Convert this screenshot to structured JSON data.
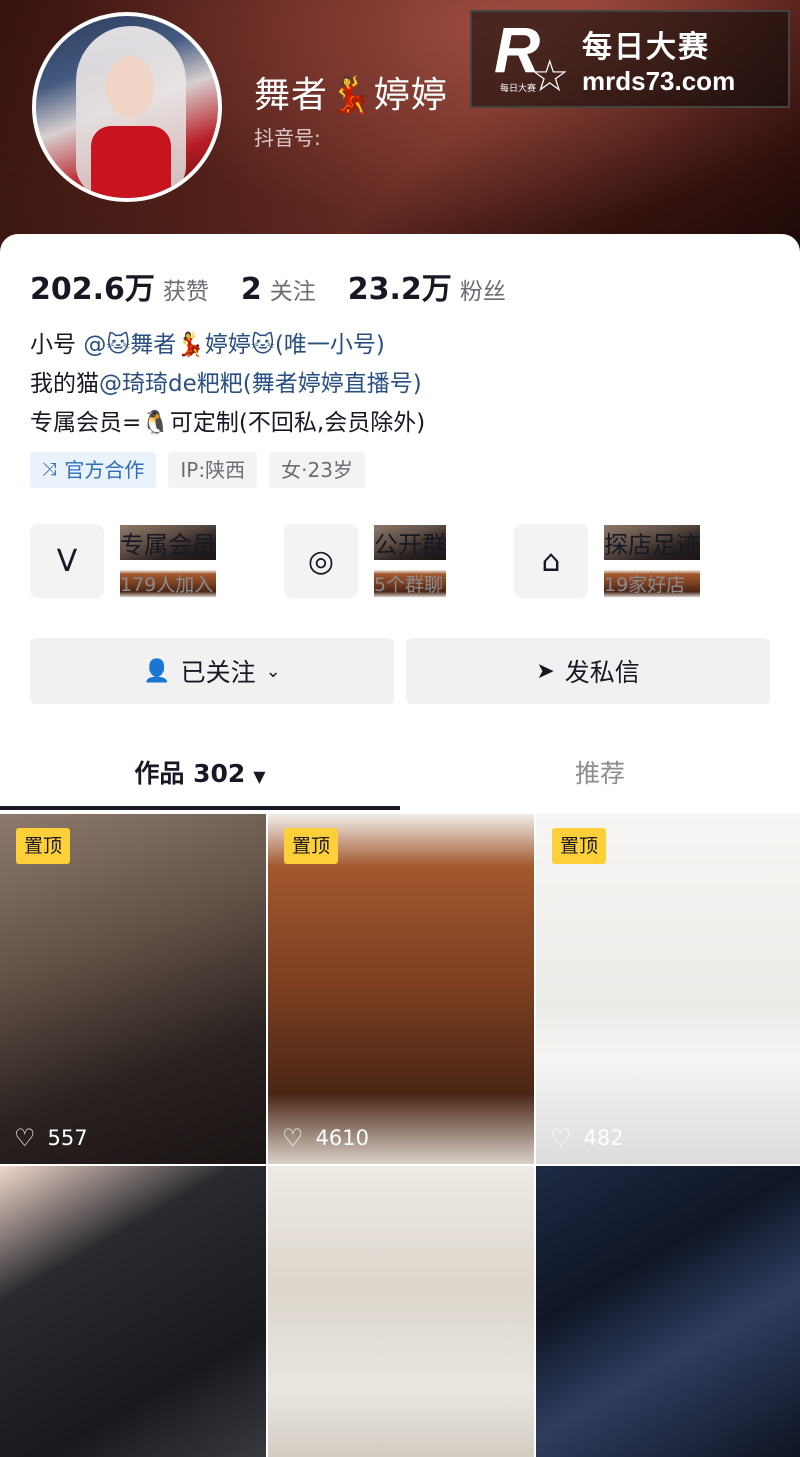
{
  "profile": {
    "nickname": "舞者💃婷婷",
    "douyin_id_label": "抖音号:"
  },
  "watermark": {
    "logo_letter": "R",
    "logo_small": "每日大赛",
    "title": "每日大赛",
    "url": "mrds73.com"
  },
  "stats": [
    {
      "num": "202.6万",
      "label": "获赞"
    },
    {
      "num": "2",
      "label": "关注"
    },
    {
      "num": "23.2万",
      "label": "粉丝"
    }
  ],
  "bio": {
    "line1_prefix": "小号",
    "line1_link": "@🐱舞者💃婷婷🐱",
    "line1_suffix": "(唯一小号)",
    "line2_prefix": "我的猫",
    "line2_link": "@琦琦de粑粑",
    "line2_suffix": "(舞者婷婷直播号)",
    "line3": "专属会员=🐧可定制(不回私,会员除外)"
  },
  "tags": {
    "official": "官方合作",
    "ip": "IP:陕西",
    "gender_age": "女·23岁"
  },
  "services": [
    {
      "icon": "vip-icon",
      "title": "专属会员",
      "sub": "179人加入"
    },
    {
      "icon": "chat-group-icon",
      "title": "公开群",
      "sub": "5个群聊"
    },
    {
      "icon": "store-icon",
      "title": "探店足迹",
      "sub": "19家好店"
    }
  ],
  "actions": {
    "follow": "已关注",
    "message": "发私信"
  },
  "tabs": {
    "works": "作品 302",
    "recommend": "推荐"
  },
  "videos": [
    {
      "pinned": "置顶",
      "likes": "557"
    },
    {
      "pinned": "置顶",
      "likes": "4610"
    },
    {
      "pinned": "置顶",
      "likes": "482"
    },
    {
      "pinned": "",
      "likes": ""
    },
    {
      "pinned": "",
      "likes": ""
    },
    {
      "pinned": "",
      "likes": ""
    }
  ],
  "colors": {
    "accent_link": "#2a4f82",
    "pin_badge": "#fdd03a",
    "official_tag": "#2e6fb8"
  }
}
